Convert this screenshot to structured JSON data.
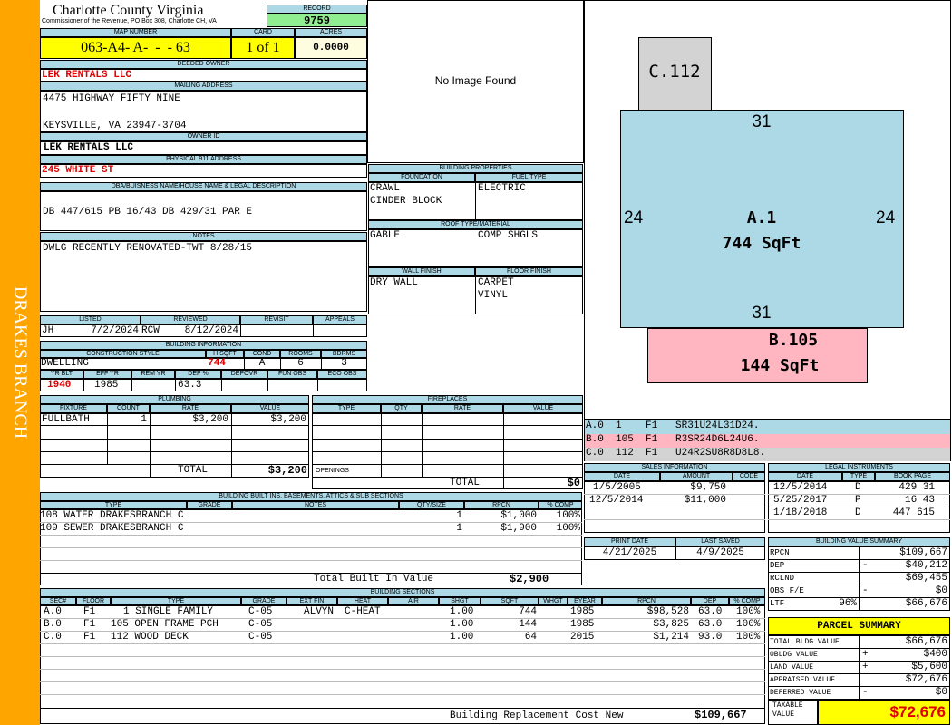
{
  "sidebar_title": "DRAKES BRANCH",
  "county": {
    "name": "Charlotte County Virginia",
    "address": "Commissioner of the Revenue, PO Box 308, Charlotte CH, VA"
  },
  "labels": {
    "record": "RECORD",
    "map_number": "MAP NUMBER",
    "card": "CARD",
    "acres": "ACRES",
    "deeded_owner": "DEEDED OWNER",
    "mailing_address": "MAILING ADDRESS",
    "owner_id": "OWNER ID",
    "physical_address": "PHYSICAL 911 ADDRESS",
    "legal_desc": "DBA/BUISNESS NAME/HOUSE NAME & LEGAL DESCRIPTION",
    "notes": "NOTES",
    "no_image": "No Image Found",
    "building_properties": "BUILDING PROPERTIES",
    "foundation": "FOUNDATION",
    "fuel_type": "FUEL TYPE",
    "roof": "ROOF TYPE/MATERIAL",
    "wall_finish": "WALL FINISH",
    "floor_finish": "FLOOR FINISH"
  },
  "record": "9759",
  "map_number": "063-A4- A-  -  - 63",
  "card": "1 of 1",
  "acres": "0.0000",
  "owner": "LEK RENTALS LLC",
  "mailing": {
    "line1": "4475 HIGHWAY FIFTY NINE",
    "line2": "KEYSVILLE, VA 23947-3704"
  },
  "owner_id": "LEK RENTALS LLC",
  "physical_address": "245 WHITE ST",
  "legal_desc": "DB 447/615 PB 16/43 DB 429/31 PAR E",
  "notes": "DWLG RECENTLY RENOVATED-TWT 8/28/15",
  "props": {
    "foundation1": "CRAWL",
    "foundation2": "CINDER BLOCK",
    "fuel": "ELECTRIC",
    "roof1": "GABLE",
    "roof2": "COMP SHGLS",
    "wall": "DRY WALL",
    "floor1": "CARPET",
    "floor2": "VINYL"
  },
  "listing": {
    "h_listed": "LISTED",
    "h_reviewed": "REVIEWED",
    "h_revisit": "REVISIT",
    "h_appeals": "APPEALS",
    "listed_by": "JH",
    "listed_date": "7/2/2024",
    "reviewed_by": "RCW",
    "reviewed_date": "8/12/2024"
  },
  "building_info": {
    "title": "BUILDING INFORMATION",
    "h_style": "CONSTRUCTION STYLE",
    "h_hsqft": "H SQFT",
    "h_cond": "COND",
    "h_rooms": "ROOMS",
    "h_bdrms": "BDRMS",
    "style": "DWELLING",
    "hsqft": "744",
    "cond": "A",
    "rooms": "6",
    "bdrms": "3",
    "h_yrblt": "YR BLT",
    "h_effyr": "EFF YR",
    "h_remyr": "REM YR",
    "h_dep": "DEP %",
    "h_depovr": "DEPOVR",
    "h_funobs": "FUN OBS",
    "h_ecoobs": "ECO OBS",
    "yrblt": "1940",
    "effyr": "1985",
    "dep": "63.3"
  },
  "plumbing": {
    "title": "PLUMBING",
    "h_fixture": "FIXTURE",
    "h_count": "COUNT",
    "h_rate": "RATE",
    "h_value": "VALUE",
    "rows": [
      {
        "fixture": "FULLBATH",
        "count": "1",
        "rate": "$3,200",
        "value": "$3,200"
      }
    ],
    "total_label": "TOTAL",
    "total": "$3,200"
  },
  "fireplaces": {
    "title": "FIREPLACES",
    "h_type": "TYPE",
    "h_qty": "QTY",
    "h_rate": "RATE",
    "h_value": "VALUE",
    "openings": "OPENINGS",
    "total_label": "TOTAL",
    "total": "$0"
  },
  "builtins": {
    "title": "BUILDING BUILT INS, BASEMENTS, ATTICS & SUB SECTIONS",
    "h_type": "TYPE",
    "h_grade": "GRADE",
    "h_notes": "NOTES",
    "h_qty": "QTY/SIZE",
    "h_rpcn": "RPCN",
    "h_comp": "% COMP",
    "rows": [
      {
        "type": "108 WATER DRAKESBRANCH C",
        "qty": "1",
        "rpcn": "$1,000",
        "comp": "100%"
      },
      {
        "type": "109 SEWER DRAKESBRANCH C",
        "qty": "1",
        "rpcn": "$1,900",
        "comp": "100%"
      }
    ],
    "total_label": "Total Built In Value",
    "total": "$2,900"
  },
  "sections": {
    "title": "BUILDING SECTIONS",
    "h_sec": "SEC#",
    "h_floor": "FLOOR",
    "h_type": "TYPE",
    "h_grade": "GRADE",
    "h_extfin": "EXT FIN",
    "h_heat": "HEAT",
    "h_air": "AIR",
    "h_shgt": "SHGT",
    "h_sqft": "SQFT",
    "h_wght": "WHGT",
    "h_eyear": "EYEAR",
    "h_rpcn": "RPCN",
    "h_dep": "DEP",
    "h_comp": "% COMP",
    "rows": [
      {
        "sec": "A.0",
        "floor": "F1",
        "type": "1 SINGLE FAMILY",
        "grade": "C-05",
        "extfin": "ALVYN",
        "heat": "C-HEAT",
        "shgt": "1.00",
        "sqft": "744",
        "eyear": "1985",
        "rpcn": "$98,528",
        "dep": "63.0",
        "comp": "100%"
      },
      {
        "sec": "B.0",
        "floor": "F1",
        "type": "105 OPEN FRAME PCH",
        "grade": "C-05",
        "extfin": "",
        "heat": "",
        "shgt": "1.00",
        "sqft": "144",
        "eyear": "1985",
        "rpcn": "$3,825",
        "dep": "63.0",
        "comp": "100%"
      },
      {
        "sec": "C.0",
        "floor": "F1",
        "type": "112 WOOD DECK",
        "grade": "C-05",
        "extfin": "",
        "heat": "",
        "shgt": "1.00",
        "sqft": "64",
        "eyear": "2015",
        "rpcn": "$1,214",
        "dep": "93.0",
        "comp": "100%"
      }
    ],
    "replacement_label": "Building Replacement Cost New",
    "replacement": "$109,667"
  },
  "sketch": {
    "c_label": "C.112",
    "a_label": "A.1",
    "a_area": "744 SqFt",
    "b_label": "B.105",
    "b_area": "144 SqFt",
    "top": "31",
    "bottom": "31",
    "left": "24",
    "right": "24",
    "colors": {
      "a": "#add8e6",
      "b": "#ffb6c1",
      "c": "#d3d3d3"
    }
  },
  "sketch_codes": [
    {
      "sec": "A.0",
      "num": "1",
      "floor": "F1",
      "code": "SR31U24L31D24.",
      "color": "#add8e6"
    },
    {
      "sec": "B.0",
      "num": "105",
      "floor": "F1",
      "code": "R3SR24D6L24U6.",
      "color": "#ffb6c1"
    },
    {
      "sec": "C.0",
      "num": "112",
      "floor": "F1",
      "code": "U24R2SU8R8D8L8.",
      "color": "#d3d3d3"
    }
  ],
  "sales": {
    "title": "SALES INFORMATION",
    "h_date": "DATE",
    "h_amount": "AMOUNT",
    "h_code": "CODE",
    "rows": [
      {
        "date": "1/5/2005",
        "amount": "$9,750"
      },
      {
        "date": "12/5/2014",
        "amount": "$11,000"
      }
    ]
  },
  "legal": {
    "title": "LEGAL INSTRUMENTS",
    "h_date": "DATE",
    "h_type": "TYPE",
    "h_book": "BOOK PAGE",
    "rows": [
      {
        "date": "12/5/2014",
        "type": "D",
        "book": "429 31"
      },
      {
        "date": "5/25/2017",
        "type": "P",
        "book": "16 43"
      },
      {
        "date": "1/18/2018",
        "type": "D",
        "book": "447 615"
      }
    ]
  },
  "print": {
    "h_print": "PRINT DATE",
    "h_saved": "LAST SAVED",
    "print_date": "4/21/2025",
    "last_saved": "4/9/2025"
  },
  "value_summary": {
    "title": "BUILDING VALUE SUMMARY",
    "rows": [
      {
        "label": "RPCN",
        "sign": "",
        "value": "$109,667"
      },
      {
        "label": "DEP",
        "sign": "-",
        "value": "$40,212"
      },
      {
        "label": "RCLND",
        "sign": "",
        "value": "$69,455"
      },
      {
        "label": "OBS F/E",
        "sign": "-",
        "value": "$0"
      },
      {
        "label": "LTF",
        "pct": "96%",
        "sign": "",
        "value": "$66,676"
      }
    ]
  },
  "parcel": {
    "title": "PARCEL SUMMARY",
    "rows": [
      {
        "label": "TOTAL BLDG VALUE",
        "sign": "",
        "value": "$66,676"
      },
      {
        "label": "OBLDG VALUE",
        "sign": "+",
        "value": "$400"
      },
      {
        "label": "LAND VALUE",
        "sign": "+",
        "value": "$5,600"
      },
      {
        "label": "APPRAISED VALUE",
        "sign": "",
        "value": "$72,676"
      },
      {
        "label": "DEFERRED VALUE",
        "sign": "-",
        "value": "$0"
      }
    ],
    "taxable_label": "TAXABLE VALUE",
    "taxable": "$72,676"
  }
}
